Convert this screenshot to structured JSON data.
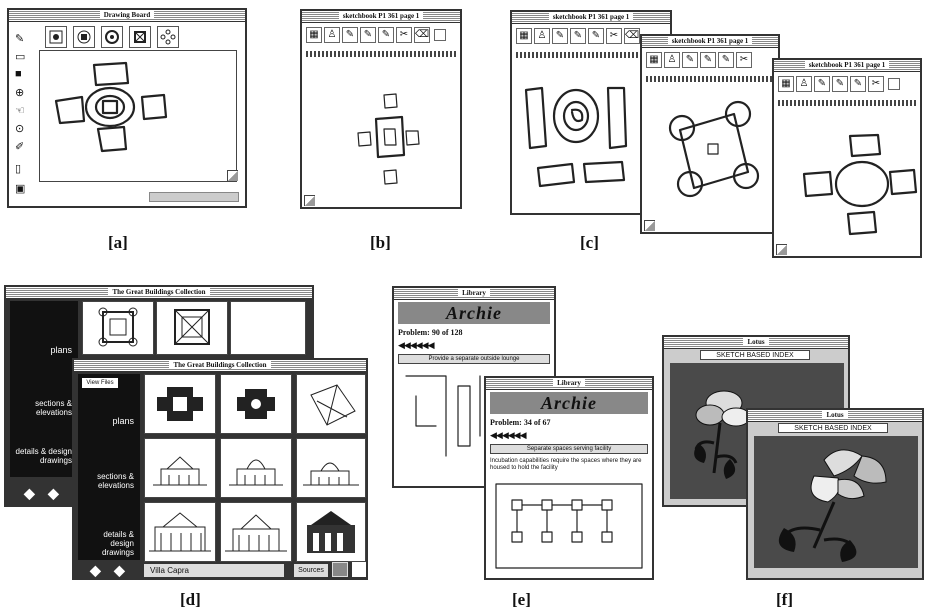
{
  "captions": {
    "a": "[a]",
    "b": "[b]",
    "c": "[c]",
    "d": "[d]",
    "e": "[e]",
    "f": "[f]"
  },
  "panel_a": {
    "title": "Drawing Board",
    "palette_icons": [
      "plan-icon-1",
      "plan-icon-2",
      "plan-icon-3",
      "plan-icon-4",
      "plan-icon-5"
    ],
    "side_tools": [
      "pen-tool",
      "eraser-tool",
      "select-tool",
      "shape-tool",
      "hand-tool",
      "zoom-tool",
      "text-tool",
      "rect-tool"
    ]
  },
  "panel_b": {
    "title": "sketchbook P1 361 page 1"
  },
  "panel_c": {
    "title1": "sketchbook P1 361 page 1",
    "title2": "sketchbook P1 361 page 1",
    "title3": "sketchbook P1 361 page 1"
  },
  "panel_d": {
    "back_title": "The Great Buildings Collection",
    "front_title": "The Great Buildings Collection",
    "view_button": "View Files",
    "rows": [
      "plans",
      "sections & elevations",
      "details & design drawings"
    ],
    "back_rows": [
      "plans",
      "sections & elevations",
      "details & design drawings"
    ],
    "search_value": "Villa Capra",
    "sources_button": "Sources"
  },
  "panel_e": {
    "back_title": "Library",
    "back_logo": "Archie",
    "back_problem": "Problem: 90 of 128",
    "back_strip": "Provide a separate outside lounge",
    "front_title": "Library",
    "front_logo": "Archie",
    "front_problem": "Problem: 34 of 67",
    "front_strip": "Separate spaces serving facility",
    "front_text": "Incubation capabilities require the spaces where they are housed to hold the facility"
  },
  "panel_f": {
    "back_title": "Lotus",
    "back_header": "SKETCH BASED INDEX",
    "front_title": "Lotus",
    "front_header": "SKETCH BASED INDEX"
  }
}
